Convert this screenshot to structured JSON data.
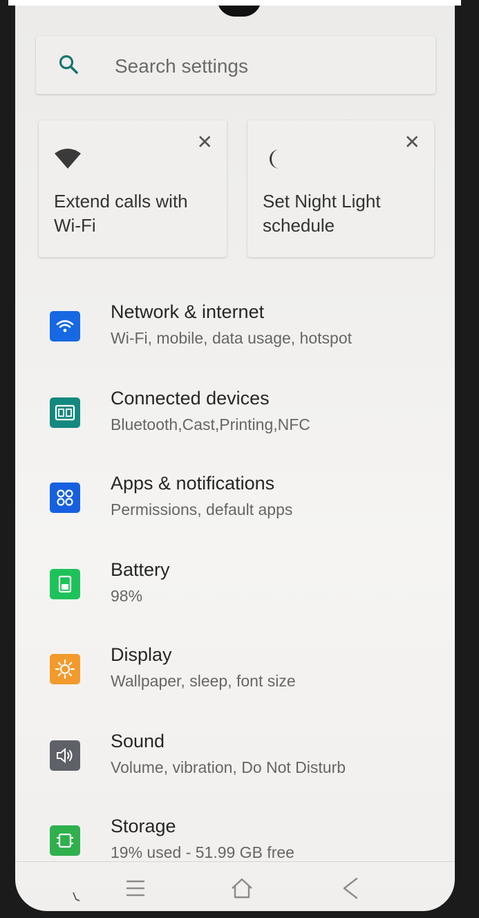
{
  "search": {
    "placeholder": "Search settings",
    "icon": "search-icon"
  },
  "suggestions": [
    {
      "icon": "wifi-icon",
      "label": "Extend calls with Wi-Fi",
      "close": "✕"
    },
    {
      "icon": "moon-icon",
      "label": "Set Night Light schedule",
      "close": "✕"
    }
  ],
  "settings": [
    {
      "title": "Network & internet",
      "subtitle": "Wi-Fi, mobile, data usage, hotspot",
      "icon": "wifi-icon",
      "color": "#1668e3"
    },
    {
      "title": "Connected devices",
      "subtitle": "Bluetooth,Cast,Printing,NFC",
      "icon": "devices-icon",
      "color": "#13897f"
    },
    {
      "title": "Apps & notifications",
      "subtitle": "Permissions, default apps",
      "icon": "apps-icon",
      "color": "#1660e0"
    },
    {
      "title": "Battery",
      "subtitle": "98%",
      "icon": "battery-icon",
      "color": "#1ec25a"
    },
    {
      "title": "Display",
      "subtitle": "Wallpaper, sleep, font size",
      "icon": "brightness-icon",
      "color": "#f39a2c"
    },
    {
      "title": "Sound",
      "subtitle": "Volume, vibration, Do Not Disturb",
      "icon": "volume-icon",
      "color": "#5f6168"
    },
    {
      "title": "Storage",
      "subtitle": "19% used - 51.99 GB free",
      "icon": "storage-icon",
      "color": "#2fb04d"
    }
  ],
  "navbar": {
    "menu": "menu-icon",
    "home": "home-icon",
    "back": "back-icon"
  }
}
